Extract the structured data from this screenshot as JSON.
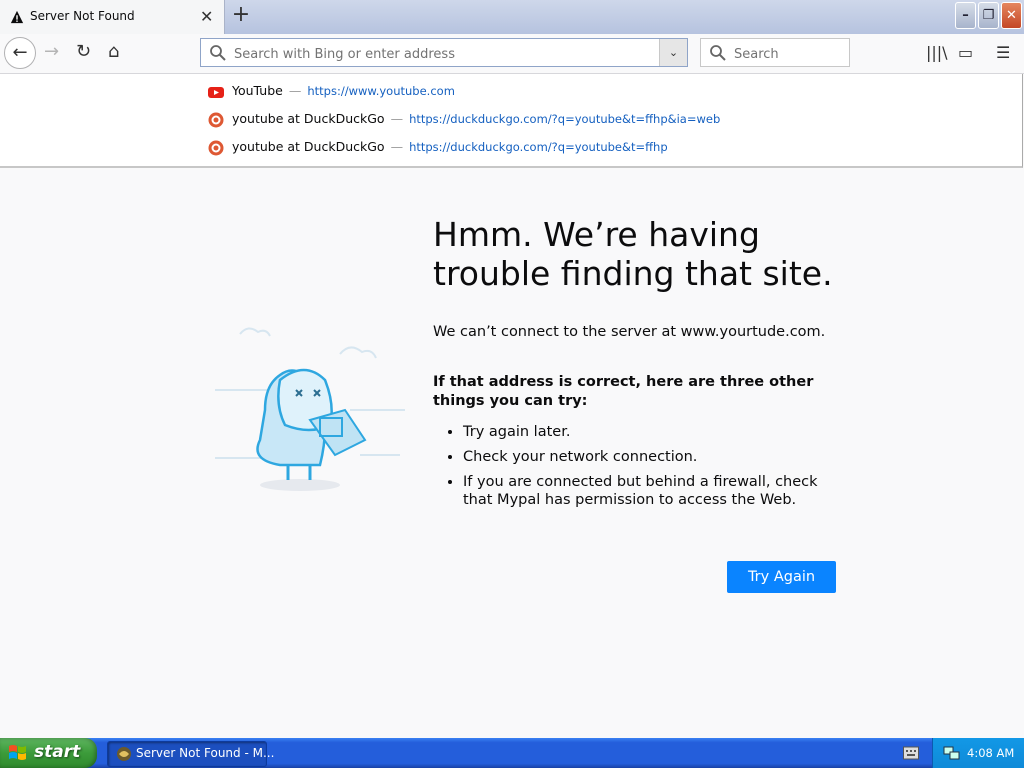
{
  "tab": {
    "title": "Server Not Found",
    "close_glyph": "✕",
    "new_tab_glyph": "+"
  },
  "window_controls": {
    "minimize": "–",
    "maximize": "❐",
    "close": "✕"
  },
  "navbar": {
    "back_glyph": "←",
    "forward_glyph": "→",
    "reload_glyph": "↻",
    "home_glyph": "⌂",
    "url_placeholder": "Search with Bing or enter address",
    "url_value": "",
    "search_placeholder": "Search",
    "dropdown_glyph": "⌄",
    "library_glyph": "|||\\",
    "sidebar_glyph": "▭",
    "menu_glyph": "☰"
  },
  "suggestions": [
    {
      "title": "YouTube",
      "separator": "—",
      "url": "https://www.youtube.com",
      "icon": "youtube-icon"
    },
    {
      "title": "youtube at DuckDuckGo",
      "separator": "—",
      "url": "https://duckduckgo.com/?q=youtube&t=ffhp&ia=web",
      "icon": "duckduckgo-icon"
    },
    {
      "title": "youtube at DuckDuckGo",
      "separator": "—",
      "url": "https://duckduckgo.com/?q=youtube&t=ffhp",
      "icon": "duckduckgo-icon"
    }
  ],
  "error": {
    "heading": "Hmm. We’re having trouble finding that site.",
    "message": "We can’t connect to the server at www.yourtude.com.",
    "subheading": "If that address is correct, here are three other things you can try:",
    "tips": [
      "Try again later.",
      "Check your network connection.",
      "If you are connected but behind a firewall, check that Mypal has permission to access the Web."
    ],
    "button": "Try Again"
  },
  "taskbar": {
    "start": "start",
    "task_button": "Server Not Found - M...",
    "clock": "4:08 AM"
  },
  "colors": {
    "accent": "#0a84ff",
    "taskbar": "#245edb",
    "start": "#3c9b3a"
  }
}
